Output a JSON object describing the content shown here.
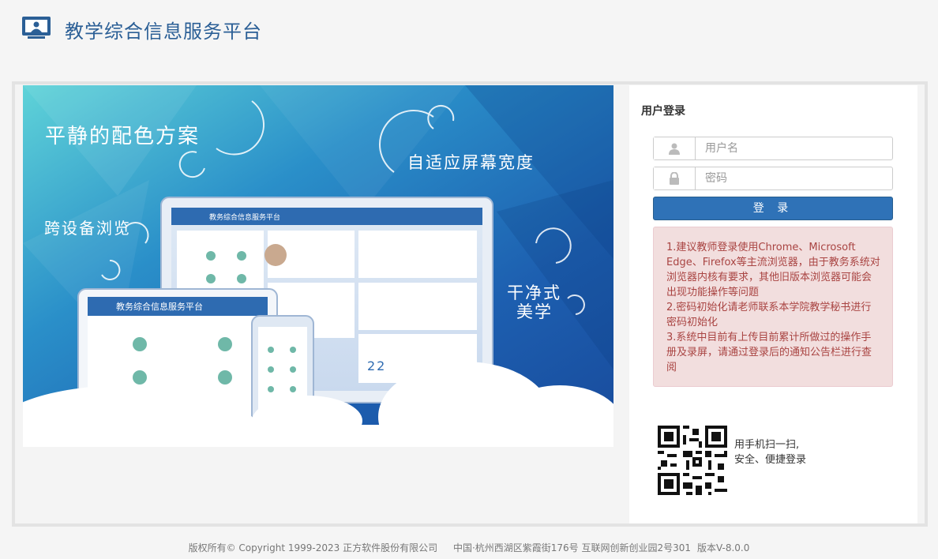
{
  "header": {
    "title": "教学综合信息服务平台",
    "logo_icon": "monitor-user-icon"
  },
  "banner": {
    "slogans": [
      "平静的配色方案",
      "自适应屏幕宽度",
      "跨设备浏览",
      "干净式",
      "美学"
    ],
    "mock_app_title": "教务综合信息服务平台",
    "mock_calendar_day": "22"
  },
  "login": {
    "title": "用户登录",
    "username_placeholder": "用户名",
    "password_placeholder": "密码",
    "submit_label": "登 录",
    "user_icon": "user-icon",
    "lock_icon": "lock-icon",
    "notices": [
      "1.建议教师登录使用Chrome、Microsoft Edge、Firefox等主流浏览器，由于教务系统对浏览器内核有要求，其他旧版本浏览器可能会出现功能操作等问题",
      "2.密码初始化请老师联系本学院教学秘书进行密码初始化",
      "3.系统中目前有上传目前累计所做过的操作手册及录屏，请通过登录后的通知公告栏进行查阅"
    ],
    "qr_text_line1": "用手机扫一扫,",
    "qr_text_line2": "安全、便捷登录",
    "colors": {
      "primary": "#2f72b7",
      "alert_bg": "#f2dede",
      "alert_text": "#a94442"
    }
  },
  "footer": {
    "copyright": "版权所有© Copyright 1999-2023 正方软件股份有限公司",
    "address": "中国·杭州西湖区紫霞街176号 互联网创新创业园2号301",
    "version": "版本V-8.0.0"
  }
}
